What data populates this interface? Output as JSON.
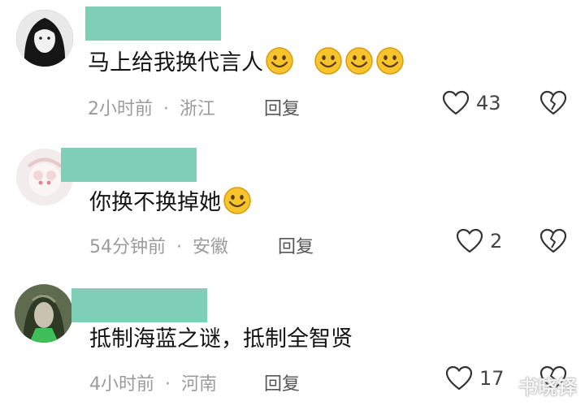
{
  "comments": [
    {
      "text": "马上给我换代言人",
      "time": "2小时前",
      "sep": "·",
      "location": "浙江",
      "reply_label": "回复",
      "likes": "43"
    },
    {
      "text": "你换不换掉她",
      "time": "54分钟前",
      "sep": "·",
      "location": "安徽",
      "reply_label": "回复",
      "likes": "2"
    },
    {
      "text": "抵制海蓝之谜，抵制全智贤",
      "time": "4小时前",
      "sep": "·",
      "location": "河南",
      "reply_label": "回复",
      "likes": "17"
    }
  ],
  "watermark": "书晓铎",
  "colors": {
    "name_mask": "#7fcfb7",
    "meta": "#9b9b9b",
    "emoji_face": "#f7c52b"
  },
  "icons": [
    "smiley-emoji-icon",
    "heart-outline-icon",
    "broken-heart-icon"
  ]
}
